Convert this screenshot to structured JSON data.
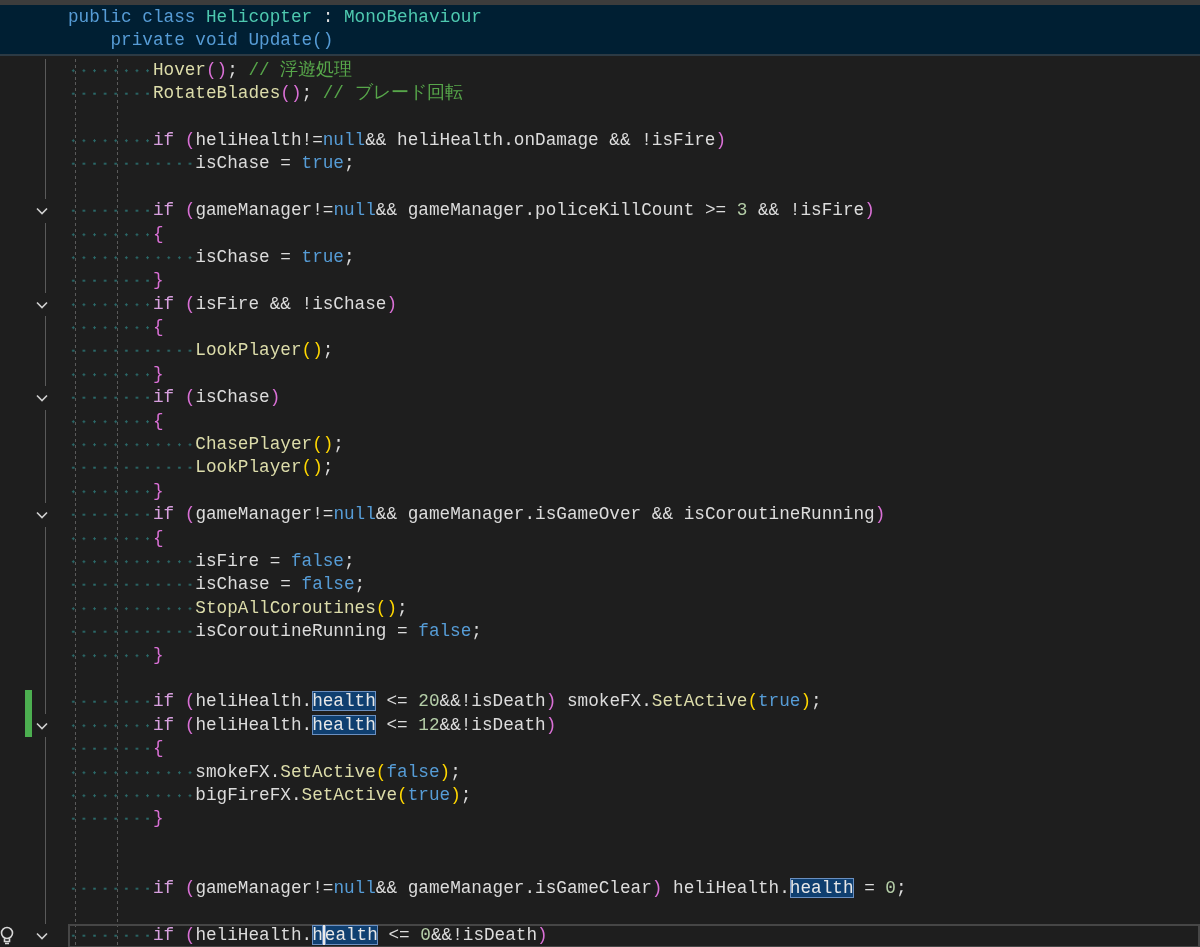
{
  "sticky_header": [
    {
      "tokens": [
        {
          "t": "public class ",
          "kind": "kw"
        },
        {
          "t": "Helicopter",
          "kind": "type"
        },
        {
          "t": " : ",
          "kind": "op"
        },
        {
          "t": "MonoBehaviour",
          "kind": "type"
        }
      ],
      "children": [
        {
          "tokens": [
            {
              "t": "private void Update()",
              "kind": "kw"
            }
          ]
        }
      ]
    }
  ],
  "lines": [
    {
      "kind": "code",
      "tokens": [
        {
          "t": "Hover",
          "kind": "fn"
        },
        {
          "t": "()",
          "kind": "p1"
        },
        {
          "t": "; ",
          "kind": "op"
        },
        {
          "t": "// 浮遊処理",
          "kind": "cmt"
        }
      ],
      "changed": false,
      "current": false
    },
    {
      "kind": "code",
      "tokens": [
        {
          "t": "RotateBlades",
          "kind": "fn"
        },
        {
          "t": "()",
          "kind": "p1"
        },
        {
          "t": "; ",
          "kind": "op"
        },
        {
          "t": "// ブレード回転",
          "kind": "cmt"
        }
      ],
      "changed": false,
      "current": false
    },
    {
      "kind": "blank"
    },
    {
      "kind": "code",
      "tokens": [
        {
          "t": "if ",
          "kind": "ctl"
        },
        {
          "t": "(",
          "kind": "p1"
        },
        {
          "t": "heliHealth!=",
          "kind": "id"
        },
        {
          "t": "null",
          "kind": "kw"
        },
        {
          "t": "&& heliHealth.onDamage && !isFire",
          "kind": "id"
        },
        {
          "t": ")",
          "kind": "p1"
        }
      ],
      "changed": false,
      "current": false,
      "children": [
        {
          "kind": "code",
          "tokens": [
            {
              "t": "isChase = ",
              "kind": "id"
            },
            {
              "t": "true",
              "kind": "kw"
            },
            {
              "t": ";",
              "kind": "id"
            }
          ],
          "changed": false,
          "current": false
        }
      ]
    },
    {
      "kind": "blank"
    },
    {
      "kind": "code",
      "tokens": [
        {
          "t": "if ",
          "kind": "ctl"
        },
        {
          "t": "(",
          "kind": "p1"
        },
        {
          "t": "gameManager!=",
          "kind": "id"
        },
        {
          "t": "null",
          "kind": "kw"
        },
        {
          "t": "&& gameManager.policeKillCount >= ",
          "kind": "id"
        },
        {
          "t": "3",
          "kind": "num"
        },
        {
          "t": " && !isFire",
          "kind": "id"
        },
        {
          "t": ")",
          "kind": "p1"
        }
      ],
      "changed": false,
      "current": false,
      "fold": {
        "expanded": true
      }
    },
    {
      "kind": "code",
      "tokens": [
        {
          "t": "{",
          "kind": "p1"
        }
      ],
      "changed": false,
      "current": false,
      "children": [
        {
          "kind": "code",
          "tokens": [
            {
              "t": "isChase = ",
              "kind": "id"
            },
            {
              "t": "true",
              "kind": "kw"
            },
            {
              "t": ";",
              "kind": "id"
            }
          ],
          "changed": false,
          "current": false
        }
      ]
    },
    {
      "kind": "code",
      "tokens": [
        {
          "t": "}",
          "kind": "p1"
        }
      ],
      "changed": false,
      "current": false
    },
    {
      "kind": "code",
      "tokens": [
        {
          "t": "if ",
          "kind": "ctl"
        },
        {
          "t": "(",
          "kind": "p1"
        },
        {
          "t": "isFire && !isChase",
          "kind": "id"
        },
        {
          "t": ")",
          "kind": "p1"
        }
      ],
      "changed": false,
      "current": false,
      "fold": {
        "expanded": true
      }
    },
    {
      "kind": "code",
      "tokens": [
        {
          "t": "{",
          "kind": "p1"
        }
      ],
      "changed": false,
      "current": false,
      "children": [
        {
          "kind": "code",
          "tokens": [
            {
              "t": "LookPlayer",
              "kind": "fn"
            },
            {
              "t": "()",
              "kind": "p2"
            },
            {
              "t": ";",
              "kind": "id"
            }
          ],
          "changed": false,
          "current": false
        }
      ]
    },
    {
      "kind": "code",
      "tokens": [
        {
          "t": "}",
          "kind": "p1"
        }
      ],
      "changed": false,
      "current": false
    },
    {
      "kind": "code",
      "tokens": [
        {
          "t": "if ",
          "kind": "ctl"
        },
        {
          "t": "(",
          "kind": "p1"
        },
        {
          "t": "isChase",
          "kind": "id"
        },
        {
          "t": ")",
          "kind": "p1"
        }
      ],
      "changed": false,
      "current": false,
      "fold": {
        "expanded": true
      }
    },
    {
      "kind": "code",
      "tokens": [
        {
          "t": "{",
          "kind": "p1"
        }
      ],
      "changed": false,
      "current": false,
      "children": [
        {
          "kind": "code",
          "tokens": [
            {
              "t": "ChasePlayer",
              "kind": "fn"
            },
            {
              "t": "()",
              "kind": "p2"
            },
            {
              "t": ";",
              "kind": "id"
            }
          ],
          "changed": false,
          "current": false
        },
        {
          "kind": "code",
          "tokens": [
            {
              "t": "LookPlayer",
              "kind": "fn"
            },
            {
              "t": "()",
              "kind": "p2"
            },
            {
              "t": ";",
              "kind": "id"
            }
          ],
          "changed": false,
          "current": false
        }
      ]
    },
    {
      "kind": "code",
      "tokens": [
        {
          "t": "}",
          "kind": "p1"
        }
      ],
      "changed": false,
      "current": false
    },
    {
      "kind": "code",
      "tokens": [
        {
          "t": "if ",
          "kind": "ctl"
        },
        {
          "t": "(",
          "kind": "p1"
        },
        {
          "t": "gameManager!=",
          "kind": "id"
        },
        {
          "t": "null",
          "kind": "kw"
        },
        {
          "t": "&& gameManager.isGameOver && isCoroutineRunning",
          "kind": "id"
        },
        {
          "t": ")",
          "kind": "p1"
        }
      ],
      "changed": false,
      "current": false,
      "fold": {
        "expanded": true
      }
    },
    {
      "kind": "code",
      "tokens": [
        {
          "t": "{",
          "kind": "p1"
        }
      ],
      "changed": false,
      "current": false,
      "children": [
        {
          "kind": "code",
          "tokens": [
            {
              "t": "isFire = ",
              "kind": "id"
            },
            {
              "t": "false",
              "kind": "kw"
            },
            {
              "t": ";",
              "kind": "id"
            }
          ],
          "changed": false,
          "current": false
        },
        {
          "kind": "code",
          "tokens": [
            {
              "t": "isChase = ",
              "kind": "id"
            },
            {
              "t": "false",
              "kind": "kw"
            },
            {
              "t": ";",
              "kind": "id"
            }
          ],
          "changed": false,
          "current": false
        },
        {
          "kind": "code",
          "tokens": [
            {
              "t": "StopAllCoroutines",
              "kind": "fn"
            },
            {
              "t": "()",
              "kind": "p2"
            },
            {
              "t": ";",
              "kind": "id"
            }
          ],
          "changed": false,
          "current": false
        },
        {
          "kind": "code",
          "tokens": [
            {
              "t": "isCoroutineRunning = ",
              "kind": "id"
            },
            {
              "t": "false",
              "kind": "kw"
            },
            {
              "t": ";",
              "kind": "id"
            }
          ],
          "changed": false,
          "current": false
        }
      ]
    },
    {
      "kind": "code",
      "tokens": [
        {
          "t": "}",
          "kind": "p1"
        }
      ],
      "changed": false,
      "current": false
    },
    {
      "kind": "blank"
    },
    {
      "kind": "code",
      "tokens": [
        {
          "t": "if ",
          "kind": "ctl"
        },
        {
          "t": "(",
          "kind": "p1"
        },
        {
          "t": "heliHealth.",
          "kind": "id"
        },
        {
          "t": "health",
          "kind": "ref"
        },
        {
          "t": " <= ",
          "kind": "id"
        },
        {
          "t": "20",
          "kind": "num"
        },
        {
          "t": "&&!isDeath",
          "kind": "id"
        },
        {
          "t": ")",
          "kind": "p1"
        },
        {
          "t": " smokeFX.",
          "kind": "id"
        },
        {
          "t": "SetActive",
          "kind": "fn"
        },
        {
          "t": "(",
          "kind": "p2"
        },
        {
          "t": "true",
          "kind": "kw"
        },
        {
          "t": ")",
          "kind": "p2"
        },
        {
          "t": ";",
          "kind": "id"
        }
      ],
      "changed": true,
      "current": false
    },
    {
      "kind": "code",
      "tokens": [
        {
          "t": "if ",
          "kind": "ctl"
        },
        {
          "t": "(",
          "kind": "p1"
        },
        {
          "t": "heliHealth.",
          "kind": "id"
        },
        {
          "t": "health",
          "kind": "ref"
        },
        {
          "t": " <= ",
          "kind": "id"
        },
        {
          "t": "12",
          "kind": "num"
        },
        {
          "t": "&&!isDeath",
          "kind": "id"
        },
        {
          "t": ")",
          "kind": "p1"
        }
      ],
      "changed": true,
      "current": false,
      "fold": {
        "expanded": true
      }
    },
    {
      "kind": "code",
      "tokens": [
        {
          "t": "{",
          "kind": "p1"
        }
      ],
      "changed": false,
      "current": false,
      "children": [
        {
          "kind": "code",
          "tokens": [
            {
              "t": "smokeFX.",
              "kind": "id"
            },
            {
              "t": "SetActive",
              "kind": "fn"
            },
            {
              "t": "(",
              "kind": "p2"
            },
            {
              "t": "false",
              "kind": "kw"
            },
            {
              "t": ")",
              "kind": "p2"
            },
            {
              "t": ";",
              "kind": "id"
            }
          ],
          "changed": false,
          "current": false
        },
        {
          "kind": "code",
          "tokens": [
            {
              "t": "bigFireFX.",
              "kind": "id"
            },
            {
              "t": "SetActive",
              "kind": "fn"
            },
            {
              "t": "(",
              "kind": "p2"
            },
            {
              "t": "true",
              "kind": "kw"
            },
            {
              "t": ")",
              "kind": "p2"
            },
            {
              "t": ";",
              "kind": "id"
            }
          ],
          "changed": false,
          "current": false
        }
      ]
    },
    {
      "kind": "code",
      "tokens": [
        {
          "t": "}",
          "kind": "p1"
        }
      ],
      "changed": false,
      "current": false
    },
    {
      "kind": "blank"
    },
    {
      "kind": "blank"
    },
    {
      "kind": "code",
      "tokens": [
        {
          "t": "if ",
          "kind": "ctl"
        },
        {
          "t": "(",
          "kind": "p1"
        },
        {
          "t": "gameManager!=",
          "kind": "id"
        },
        {
          "t": "null",
          "kind": "kw"
        },
        {
          "t": "&& gameManager.isGameClear",
          "kind": "id"
        },
        {
          "t": ")",
          "kind": "p1"
        },
        {
          "t": " heliHealth.",
          "kind": "id"
        },
        {
          "t": "health",
          "kind": "ref"
        },
        {
          "t": " = ",
          "kind": "id"
        },
        {
          "t": "0",
          "kind": "num"
        },
        {
          "t": ";",
          "kind": "id"
        }
      ],
      "changed": false,
      "current": false
    },
    {
      "kind": "blank"
    },
    {
      "kind": "code",
      "tokens": [
        {
          "t": "if ",
          "kind": "ctl"
        },
        {
          "t": "(",
          "kind": "p1"
        },
        {
          "t": "heliHealth.",
          "kind": "id"
        },
        {
          "t": "h",
          "kind": "ref",
          "caret": true
        },
        {
          "t": "ealth",
          "kind": "ref"
        },
        {
          "t": " <= ",
          "kind": "id"
        },
        {
          "t": "0",
          "kind": "num"
        },
        {
          "t": "&&!isDeath",
          "kind": "id"
        },
        {
          "t": ")",
          "kind": "p1"
        }
      ],
      "changed": false,
      "current": true,
      "fold": {
        "expanded": true
      }
    }
  ]
}
